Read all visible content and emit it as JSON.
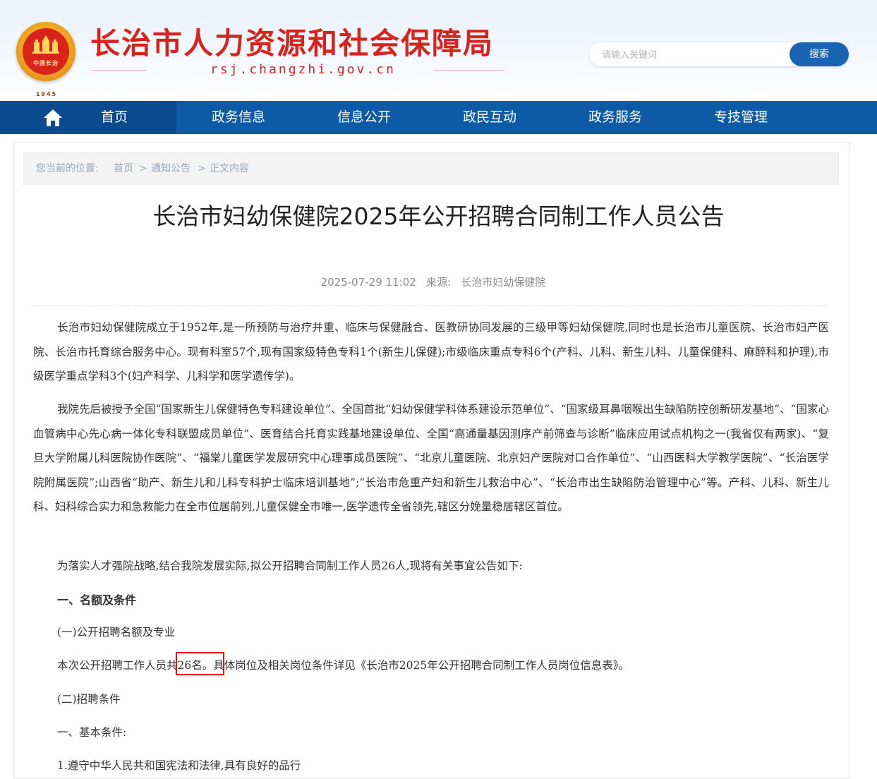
{
  "header": {
    "emblem_text": "中国长治",
    "emblem_year": "1945",
    "site_title": "长治市人力资源和社会保障局",
    "site_domain": "rsj.changzhi.gov.cn"
  },
  "search": {
    "placeholder": "请输入关键词",
    "button_label": "搜索"
  },
  "nav": {
    "items": [
      {
        "label": "首页"
      },
      {
        "label": "政务信息"
      },
      {
        "label": "信息公开"
      },
      {
        "label": "政民互动"
      },
      {
        "label": "政务服务"
      },
      {
        "label": "专技管理"
      }
    ]
  },
  "breadcrumb": {
    "prefix": "您当前的位置:",
    "items": [
      {
        "label": "首页"
      },
      {
        "label": "通知公告"
      },
      {
        "label": "正文内容"
      }
    ],
    "separator": ">"
  },
  "article": {
    "title": "长治市妇幼保健院2025年公开招聘合同制工作人员公告",
    "date": "2025-07-29 11:02",
    "source_label": "来源:",
    "source": "长治市妇幼保健院",
    "paragraphs": [
      "长治市妇幼保健院成立于1952年,是一所预防与治疗并重、临床与保健融合、医教研协同发展的三级甲等妇幼保健院,同时也是长治市儿童医院、长治市妇产医院、长治市托育综合服务中心。现有科室57个,现有国家级特色专科1个(新生儿保健);市级临床重点专科6个(产科、儿科、新生儿科、儿童保健科、麻醉科和护理),市级医学重点学科3个(妇产科学、儿科学和医学遗传学)。",
      "我院先后被授予全国“国家新生儿保健特色专科建设单位”、全国首批“妇幼保健学科体系建设示范单位”、“国家级耳鼻咽喉出生缺陷防控创新研发基地”、“国家心血管病中心先心病一体化专科联盟成员单位”、医育结合托育实践基地建设单位、全国“高通量基因测序产前筛查与诊断”临床应用试点机构之一(我省仅有两家)、“复旦大学附属儿科医院协作医院”、“福棠儿童医学发展研究中心理事成员医院”、“北京儿童医院、北京妇产医院对口合作单位”、“山西医科大学教学医院”、“长治医学院附属医院”;山西省“助产、新生儿和儿科专科护士临床培训基地”;“长治市危重产妇和新生儿救治中心”、“长治市出生缺陷防治管理中心”等。产科、儿科、新生儿科、妇科综合实力和急救能力在全市位居前列,儿童保健全市唯一,医学遗传全省领先,辖区分娩量稳居辖区首位。"
    ],
    "intro_line": "为落实人才强院战略,结合我院发展实际,拟公开招聘合同制工作人员26人,现将有关事宜公告如下:",
    "section1_heading": "一、名额及条件",
    "sub1_heading": "(一)公开招聘名额及专业",
    "quota_before": "本次公开招聘工作人员",
    "quota_highlight": "共26名。",
    "quota_after": "具体岗位及相关岗位条件详见《长治市2025年公开招聘合同制工作人员岗位信息表》。",
    "sub2_heading": "(二)招聘条件",
    "basic_heading": "一、基本条件:",
    "partial_line": "1.遵守中华人民共和国宪法和法律,具有良好的品行"
  }
}
